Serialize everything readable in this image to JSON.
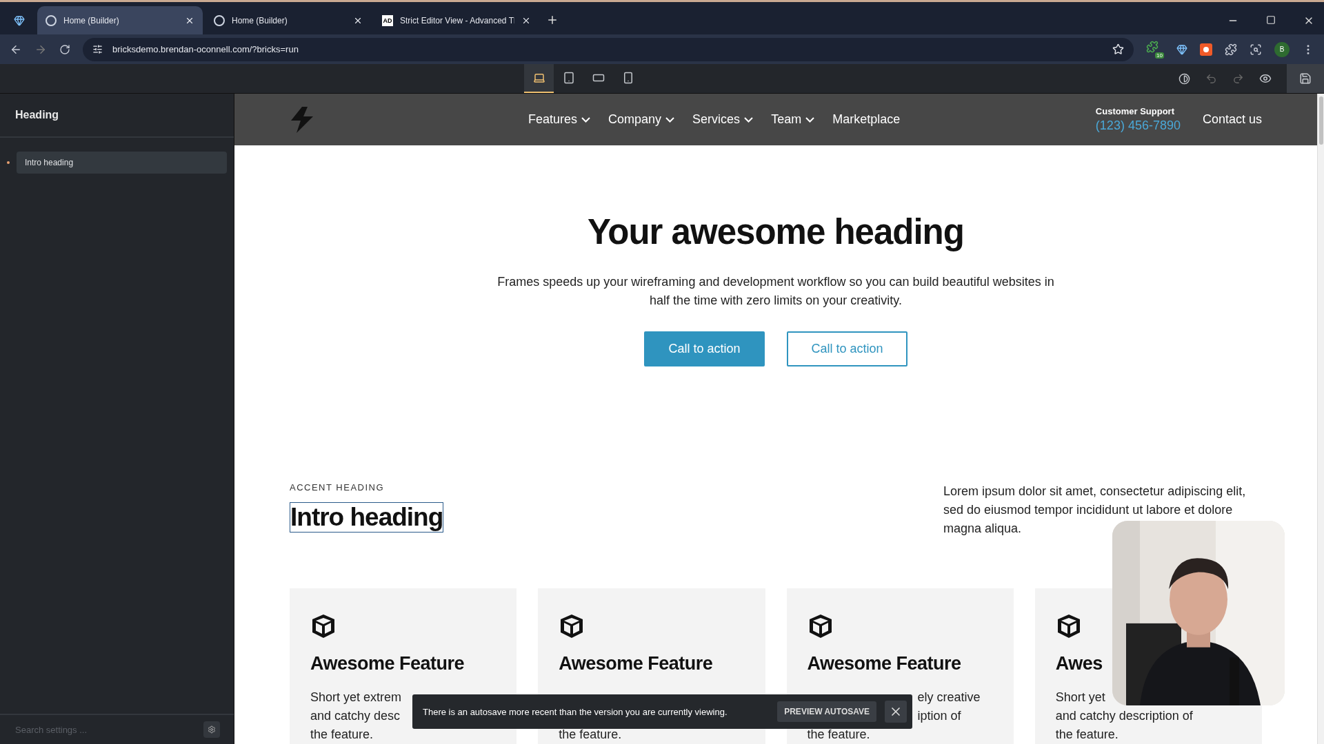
{
  "browser": {
    "tabs": [
      {
        "title": "Home (Builder)",
        "selected": true
      },
      {
        "title": "Home (Builder)",
        "selected": false
      },
      {
        "title": "Strict Editor View - Advanced Tl",
        "selected": false,
        "icon_text": "AD"
      }
    ],
    "url": "bricksdemo.brendan-oconnell.com/?bricks=run",
    "extension_badge": "10",
    "profile_initial": "B"
  },
  "builder_toolbar": {
    "devices": [
      {
        "kind": "desktop",
        "selected": true
      },
      {
        "kind": "tablet",
        "selected": false
      },
      {
        "kind": "landscape",
        "selected": false
      },
      {
        "kind": "mobile",
        "selected": false
      }
    ]
  },
  "sidebar": {
    "title": "Heading",
    "items": [
      {
        "label": "Intro heading",
        "selected": true
      }
    ],
    "search_placeholder": "Search settings ..."
  },
  "site_nav": {
    "items": [
      {
        "label": "Features",
        "dropdown": true
      },
      {
        "label": "Company",
        "dropdown": true
      },
      {
        "label": "Services",
        "dropdown": true
      },
      {
        "label": "Team",
        "dropdown": true
      },
      {
        "label": "Marketplace",
        "dropdown": false
      }
    ],
    "support_label": "Customer Support",
    "phone": "(123) 456-7890",
    "contact": "Contact us"
  },
  "hero": {
    "title": "Your awesome heading",
    "text": "Frames speeds up your wireframing and development workflow so you can build beautiful websites in half the time with zero limits on your creativity.",
    "buttons": [
      {
        "label": "Call to action",
        "kind": "filled"
      },
      {
        "label": "Call to action",
        "kind": "outline"
      }
    ]
  },
  "intro": {
    "accent": "ACCENT HEADING",
    "title": "Intro heading",
    "selected": true,
    "text": "Lorem ipsum dolor sit amet, consectetur adipiscing elit, sed do eiusmod tempor incididunt ut labore et dolore magna aliqua."
  },
  "cards": [
    {
      "title": "Awesome Feature",
      "lines": [
        {
          "text": "Short yet extrem",
          "kind": "head"
        },
        {
          "text": "and catchy desc",
          "kind": "head"
        },
        {
          "text": "the feature.",
          "kind": "head"
        }
      ]
    },
    {
      "title": "Awesome Feature",
      "lines": [
        {
          "text": "the feature.",
          "kind": "head"
        }
      ]
    },
    {
      "title": "Awesome Feature",
      "lines": [
        {
          "text": "ely creative",
          "kind": "tail"
        },
        {
          "text": "iption of",
          "kind": "tail"
        },
        {
          "text": "the feature.",
          "kind": "head"
        }
      ]
    },
    {
      "title": "Awes",
      "lines": [
        {
          "text": "Short yet",
          "kind": "head"
        },
        {
          "text": "and catchy description of",
          "kind": "head"
        },
        {
          "text": "the feature.",
          "kind": "head"
        }
      ]
    }
  ],
  "toast": {
    "text": "There is an autosave more recent than the version you are currently viewing.",
    "button": "PREVIEW AUTOSAVE"
  }
}
